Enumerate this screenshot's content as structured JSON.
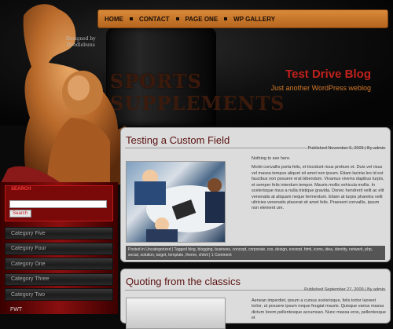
{
  "header": {
    "logo_line1": "SPORTS",
    "logo_line2": "SUPPLEMENTS",
    "designed_by_line1": "Designed by",
    "designed_by_line2": "Doodlebuns",
    "site_title": "Test Drive Blog",
    "tagline": "Just another WordPress weblog"
  },
  "nav": {
    "items": [
      {
        "label": "HOME"
      },
      {
        "label": "CONTACT"
      },
      {
        "label": "PAGE ONE"
      },
      {
        "label": "WP GALLERY"
      }
    ]
  },
  "sidebar": {
    "search_label": "SEARCH",
    "search_value": "",
    "search_button": "Search",
    "categories": [
      {
        "label": "Category Five"
      },
      {
        "label": "Category Four"
      },
      {
        "label": "Category One"
      },
      {
        "label": "Category Three"
      },
      {
        "label": "Category Two"
      },
      {
        "label": "FWT"
      }
    ]
  },
  "posts": [
    {
      "title": "Testing a Custom Field",
      "meta": "Published November 5, 2009 | By admin",
      "intro": "Nothing to see here.",
      "body": "Morbi convallis porta felis, et tincidunt risus pretium et. Duis vel risus vel massa tempus aliquet sit amet non ipsum. Etiam lacinia leo id est faucibus non posuere erat bibendum. Vivamus viverra dapibus turpis, et semper felis interdum tempor. Mauris mollis vehicula mollis. In scelerisque risus a nulla tristique gravida. Donec hendrerit velit ac elit venenatis at aliquam neque fermentum. Etiam at turpis pharetra velit ultricies venenatis placerat sit amet felis. Praesent convallis, ipsum non element um.",
      "tags": "Posted in Uncategorized | Tagged blog, blogging, business, concept, corporate, css, design, excerpt, html, icons, idea, identity, network, php, social, solution, target, template, theme, xhtml | 1 Comment"
    },
    {
      "title": "Quoting from the classics",
      "meta": "Published September 27, 2009 | By admin",
      "body": "Aenean imperdiet, ipsum a cursus scelerisque, felis tortor laoreet tortor, ut posuere ipsum neque feugiat mauris. Quisque varius massa dictum lorem pellentesque accumsan. Nunc massa eros, pellentesque et"
    }
  ],
  "colors": {
    "nav_bg": "#c9772a",
    "site_title": "#c0211c",
    "tagline": "#d47a2a",
    "sidebar_red": "#8a0f0f",
    "post_title": "#5a1010"
  }
}
